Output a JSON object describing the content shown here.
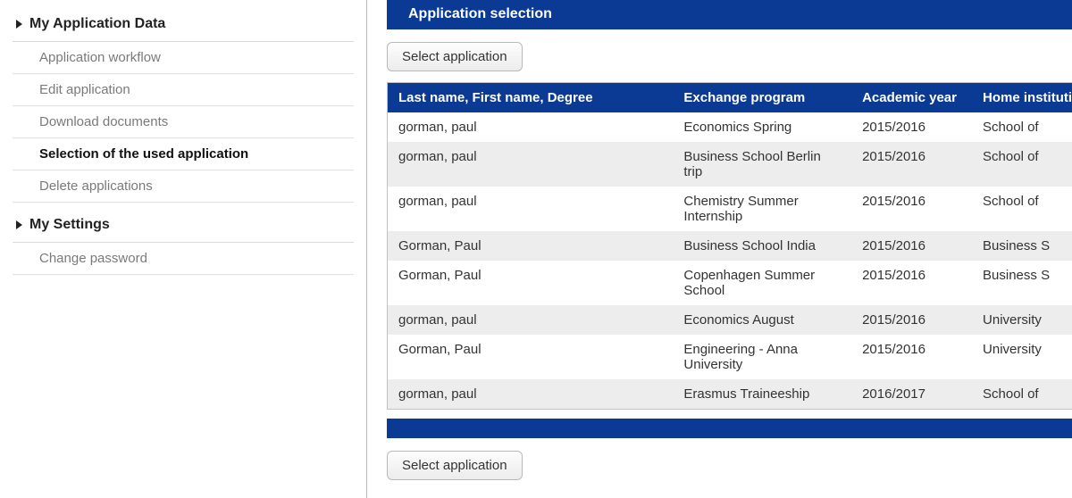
{
  "sidebar": {
    "sections": [
      {
        "title": "My Application Data",
        "items": [
          {
            "label": "Application workflow",
            "active": false
          },
          {
            "label": "Edit application",
            "active": false
          },
          {
            "label": "Download documents",
            "active": false
          },
          {
            "label": "Selection of the used application",
            "active": true
          },
          {
            "label": "Delete applications",
            "active": false
          }
        ]
      },
      {
        "title": "My Settings",
        "items": [
          {
            "label": "Change password",
            "active": false
          }
        ]
      }
    ]
  },
  "main": {
    "panel_title": "Application selection",
    "select_button_label": "Select application",
    "table": {
      "headers": {
        "name": "Last name, First name, Degree",
        "program": "Exchange program",
        "year": "Academic year",
        "institution": "Home institution"
      },
      "rows": [
        {
          "name": "gorman, paul",
          "program": "Economics Spring",
          "year": "2015/2016",
          "institution": "School of"
        },
        {
          "name": "gorman, paul",
          "program": "Business School Berlin trip",
          "year": "2015/2016",
          "institution": "School of"
        },
        {
          "name": "gorman, paul",
          "program": "Chemistry Summer Internship",
          "year": "2015/2016",
          "institution": "School of"
        },
        {
          "name": "Gorman, Paul",
          "program": "Business School India",
          "year": "2015/2016",
          "institution": "Business S"
        },
        {
          "name": "Gorman, Paul",
          "program": "Copenhagen Summer School",
          "year": "2015/2016",
          "institution": "Business S"
        },
        {
          "name": "gorman, paul",
          "program": "Economics August",
          "year": "2015/2016",
          "institution": "University"
        },
        {
          "name": "Gorman, Paul",
          "program": "Engineering - Anna University",
          "year": "2015/2016",
          "institution": "University"
        },
        {
          "name": "gorman, paul",
          "program": "Erasmus Traineeship",
          "year": "2016/2017",
          "institution": "School of"
        }
      ]
    }
  }
}
